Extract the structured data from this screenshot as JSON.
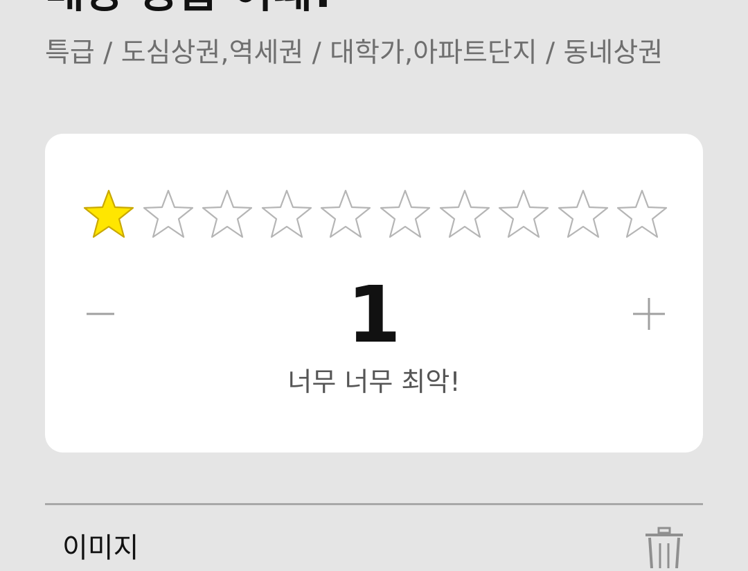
{
  "header": {
    "title": "매장 등급 어때?",
    "subtitle": "특급 / 도심상권,역세권 / 대학가,아파트단지 / 동네상권"
  },
  "rating": {
    "max_stars": 10,
    "filled_stars": 1,
    "score": "1",
    "description": "너무 너무 최악!",
    "minus_icon": "minus-icon",
    "plus_icon": "plus-icon",
    "star_icon": "star-icon"
  },
  "images_section": {
    "label": "이미지",
    "delete_icon": "trash-icon"
  },
  "colors": {
    "background": "#e5e5e5",
    "card": "#ffffff",
    "star_filled": "#ffe600",
    "star_filled_stroke": "#c9a800",
    "star_empty_stroke": "#b5b5b5",
    "subtitle": "#6f6f6f",
    "control": "#a0a0a0"
  }
}
